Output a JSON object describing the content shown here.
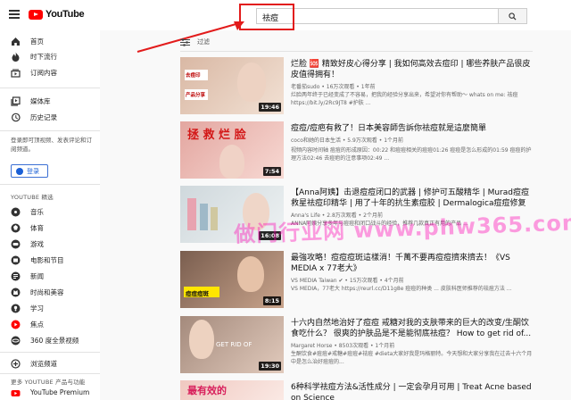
{
  "header": {
    "logo_text": "YouTube",
    "search_value": "祛痘"
  },
  "sidebar": {
    "items": [
      {
        "label": "首页",
        "icon": "home-icon"
      },
      {
        "label": "时下流行",
        "icon": "trending-icon"
      },
      {
        "label": "订阅内容",
        "icon": "subscriptions-icon"
      },
      {
        "label": "媒体库",
        "icon": "library-icon"
      },
      {
        "label": "历史记录",
        "icon": "history-icon"
      }
    ],
    "signin_note": "登录即可顶视频、发表评论和订阅频道。",
    "signin_label": "登录",
    "best_heading": "YOUTUBE 精选",
    "best_items": [
      {
        "label": "音乐",
        "icon": "music-icon"
      },
      {
        "label": "体育",
        "icon": "sports-icon"
      },
      {
        "label": "游戏",
        "icon": "gaming-icon"
      },
      {
        "label": "电影和节目",
        "icon": "movies-icon"
      },
      {
        "label": "新闻",
        "icon": "news-icon"
      },
      {
        "label": "时尚和美容",
        "icon": "fashion-icon"
      },
      {
        "label": "学习",
        "icon": "learning-icon"
      },
      {
        "label": "焦点",
        "icon": "spotlight-icon"
      },
      {
        "label": "360 度全景视频",
        "icon": "vr-icon"
      },
      {
        "label": "浏览频道",
        "icon": "browse-channels-icon"
      }
    ],
    "more_heading": "更多 YOUTUBE 产品与功能",
    "premium_label": "YouTube Premium"
  },
  "filter": {
    "label": "过滤"
  },
  "results": [
    {
      "title": "烂脸 🆘 精致好皮心得分享 | 我如何高效去痘印 | 哪些养肤产品很皮皮值得拥有！",
      "meta": "老番茄sudo • 16万次观看 • 1年前",
      "desc": "烂脸两年终于已经变成了不容易，把我的经验分享出来，希望对你有帮助～ whats on me: 祛痘 https://bit.ly/2Rc9JT8 #护肤 ...",
      "duration": "19:46",
      "thumb_colors": [
        "#d9b8a4",
        "#f2e1d4"
      ]
    },
    {
      "title": "痘痘/痘疤有救了！日本美容師告訴你祛痘就是這麼簡單",
      "meta": "coco和她的日本生活 • 5.9万次观看 • 1个月前",
      "desc": "视频内容时间轴 痘痘的形成原因：00:22 和痘痘相关的痘痘01:26 痘痘是怎么形成的01:59 痘痘的护理方法02:46 去痘疤的注意事项02:49 ...",
      "duration": "7:54",
      "thumb_colors": [
        "#e3a6a0",
        "#f7d9d3"
      ]
    },
    {
      "title": "【Anna阿姨】击退痘痘闭口的武器 | 修护可五酸精华 | Murad痘痘救星祛痘印精华 | 用了十年的抗生素痘胶 | Dermalogica痘痘修复精华 | 宝...",
      "meta": "Anna's Life • 2.8万次观看 • 2个月前",
      "desc": "ANNA阿姨分享多年与痘痘和闭口战斗的经验，推荐几款真正有用的产品 ...",
      "duration": "16:08",
      "thumb_colors": [
        "#cfd8dc",
        "#eef2f3"
      ]
    },
    {
      "title": "最強攻略！痘痘痘斑這樣消！千萬不要再痘痘擠來擠去！《VS MEDIA x 77老大》",
      "meta": "VS MEDIA Taiwan ✔ • 15万次观看 • 4个月前",
      "desc": "VS MEDIA，77老大 https://reurl.cc/D11g8e 痘痘的种类 ... 皮肤科医师推荐的祛痘方法 ...",
      "duration": "8:15",
      "thumb_colors": [
        "#7a5e4f",
        "#c9a48c"
      ]
    },
    {
      "title": "十六内自然地治好了痘痘 戒糖对我的支肤带来的巨大的改变/生酮饮食吃什么？ 很爽的护肤品是不是能彻底祛痘？ How to get rid of...",
      "meta": "Margaret Horse • 8503次观看 • 1个月前",
      "desc": "生酮饮食#痘痘#戒糖#痘痘#祛痘 #dieta大家好我是玛格丽特。今天想和大家分享我在过去十六个月中是怎么治好痘痘的...",
      "duration": "19:30",
      "thumb_colors": [
        "#a48a7c",
        "#e1cabc"
      ]
    },
    {
      "title": "6种科学祛痘方法&活性成分 | 一定会孕月可用 | Treat Acne based on Science",
      "meta": "",
      "desc": "",
      "duration": "",
      "thumb_colors": [
        "#f0c8c0",
        "#fae9e4"
      ]
    }
  ],
  "thumb_captions": {
    "r1_a": "去痘印",
    "r1_b": "产品分享",
    "r2_main": "拯 救 烂 脸",
    "r4_main": "痘痘痘斑",
    "r5_main": "GET RID OF",
    "r6_main": "最有效的"
  },
  "watermark_text": "做门行业网 www.phw365.com",
  "colors": {
    "accent_red": "#e21b1b",
    "youtube_red": "#ff0000",
    "signin_blue": "#1a5fd6"
  }
}
